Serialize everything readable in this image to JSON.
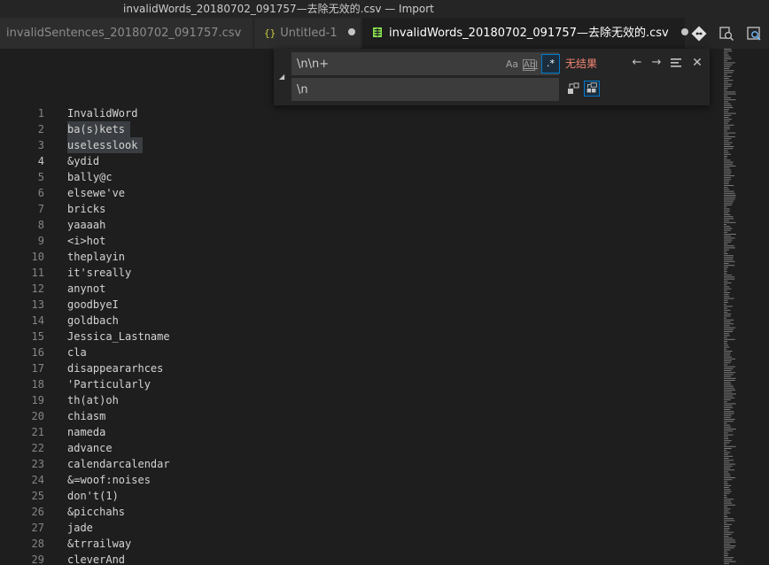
{
  "window": {
    "title": "invalidWords_20180702_091757—去除无效的.csv — Import"
  },
  "tabs": [
    {
      "label": "invalidSentences_20180702_091757.csv"
    },
    {
      "icon": "{}",
      "label": "Untitled-1"
    },
    {
      "label": "invalidWords_20180702_091757—去除无效的.csv"
    }
  ],
  "find": {
    "query": "\\n\\n+",
    "replace": "\\n",
    "match_case": "Aa",
    "whole_word": "Abl",
    "regex": ".*",
    "status": "无结果"
  },
  "editor": {
    "active_line": 4,
    "highlighted_lines": [
      2,
      3
    ],
    "lines": [
      {
        "n": "1",
        "text": "InvalidWord"
      },
      {
        "n": "2",
        "text": "ba(s)kets"
      },
      {
        "n": "3",
        "text": "uselesslook"
      },
      {
        "n": "4",
        "text": "&ydid"
      },
      {
        "n": "5",
        "text": "bally@c"
      },
      {
        "n": "6",
        "text": "elsewe've"
      },
      {
        "n": "7",
        "text": "bricks"
      },
      {
        "n": "8",
        "text": "yaaaah"
      },
      {
        "n": "9",
        "text": "<i>hot"
      },
      {
        "n": "10",
        "text": "theplayin"
      },
      {
        "n": "11",
        "text": "it'sreally"
      },
      {
        "n": "12",
        "text": "anynot"
      },
      {
        "n": "13",
        "text": "goodbyeI"
      },
      {
        "n": "14",
        "text": "goldbach"
      },
      {
        "n": "15",
        "text": "Jessica_Lastname"
      },
      {
        "n": "16",
        "text": "cla"
      },
      {
        "n": "17",
        "text": "disappeararhces"
      },
      {
        "n": "18",
        "text": "'Particularly"
      },
      {
        "n": "19",
        "text": "th(at)oh"
      },
      {
        "n": "20",
        "text": "chiasm"
      },
      {
        "n": "21",
        "text": "nameda"
      },
      {
        "n": "22",
        "text": "advance"
      },
      {
        "n": "23",
        "text": "calendarcalendar"
      },
      {
        "n": "24",
        "text": "&=woof:noises"
      },
      {
        "n": "25",
        "text": "don't(1)"
      },
      {
        "n": "26",
        "text": "&picchahs"
      },
      {
        "n": "27",
        "text": "jade"
      },
      {
        "n": "28",
        "text": "&trrailway"
      },
      {
        "n": "29",
        "text": "cleverAnd"
      }
    ]
  }
}
